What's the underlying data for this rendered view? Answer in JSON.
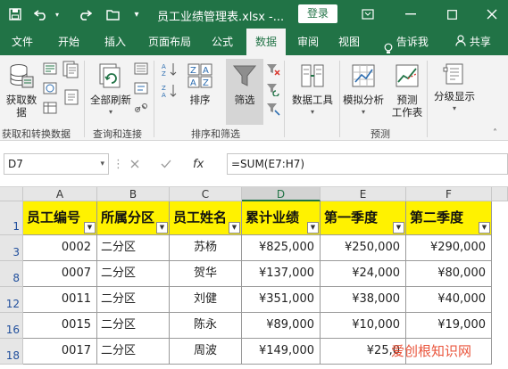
{
  "title_bar": {
    "document_title": "员工业绩管理表.xlsx  -...",
    "login_label": "登录",
    "icons": [
      "save-icon",
      "undo-icon",
      "redo-icon",
      "open-icon",
      "customize-icon",
      "restore-icon",
      "minimize-icon",
      "close-icon"
    ]
  },
  "tabs": [
    "文件",
    "开始",
    "插入",
    "页面布局",
    "公式",
    "数据",
    "审阅",
    "视图",
    "告诉我",
    "共享"
  ],
  "active_tab": "数据",
  "ribbon": {
    "get_data": "获取数\n据",
    "refresh_all": "全部刷新",
    "sort": "排序",
    "filter": "筛选",
    "data_tools": "数据工具",
    "what_if": "模拟分析",
    "forecast_sheet": "预测\n工作表",
    "outline": "分级显示",
    "groups": [
      "获取和转换数据",
      "查询和连接",
      "排序和筛选",
      "预测"
    ]
  },
  "formula_bar": {
    "name_box": "D7",
    "fx_label": "fx",
    "formula": "=SUM(E7:H7)"
  },
  "grid": {
    "columns": [
      "A",
      "B",
      "C",
      "D",
      "E",
      "F"
    ],
    "selected_column": "D",
    "headers": [
      "员工编号",
      "所属分区",
      "员工姓名",
      "累计业绩",
      "第一季度",
      "第二季度"
    ],
    "rows": [
      {
        "row": "3",
        "id": "0002",
        "area": "二分区",
        "name": "苏杨",
        "total": "¥825,000",
        "q1": "¥250,000",
        "q2": "¥290,000"
      },
      {
        "row": "8",
        "id": "0007",
        "area": "二分区",
        "name": "贺华",
        "total": "¥137,000",
        "q1": "¥24,000",
        "q2": "¥80,000"
      },
      {
        "row": "12",
        "id": "0011",
        "area": "二分区",
        "name": "刘健",
        "total": "¥351,000",
        "q1": "¥38,000",
        "q2": "¥40,000"
      },
      {
        "row": "16",
        "id": "0015",
        "area": "二分区",
        "name": "陈永",
        "total": "¥89,000",
        "q1": "¥10,000",
        "q2": "¥19,000"
      },
      {
        "row": "18",
        "id": "0017",
        "area": "二分区",
        "name": "周波",
        "total": "¥149,000",
        "q1": "¥25,0",
        "q2": ""
      }
    ],
    "header_row": "1"
  },
  "watermark": "爱创根知识网",
  "colors": {
    "excel_green": "#217346",
    "header_fill": "#fff200",
    "ribbon_bg": "#f3f3f3"
  }
}
